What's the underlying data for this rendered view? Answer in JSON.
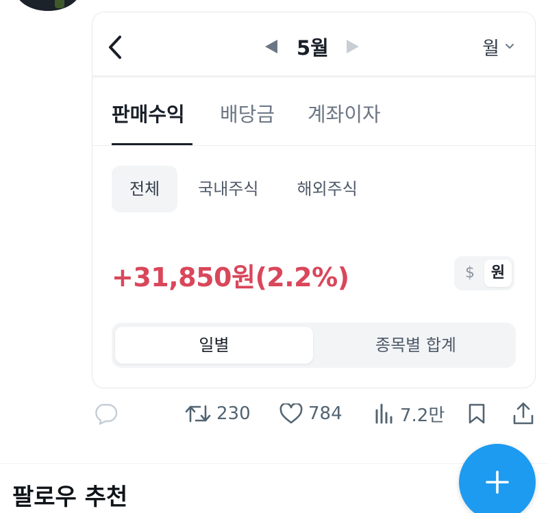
{
  "card": {
    "header": {
      "back_icon": "chevron-left-icon",
      "month": "5월",
      "prev_icon": "triangle-left-icon",
      "next_icon": "triangle-right-icon",
      "period_label": "월",
      "period_icon": "chevron-down-icon"
    },
    "tabs": [
      {
        "label": "판매수익",
        "active": true
      },
      {
        "label": "배당금",
        "active": false
      },
      {
        "label": "계좌이자",
        "active": false
      }
    ],
    "chips": [
      {
        "label": "전체",
        "active": true
      },
      {
        "label": "국내주식",
        "active": false
      },
      {
        "label": "해외주식",
        "active": false
      }
    ],
    "profit_text": "+31,850원(2.2%)",
    "currency": {
      "usd": "$",
      "krw": "원",
      "selected": "원"
    },
    "segments": [
      {
        "label": "일별",
        "active": true
      },
      {
        "label": "종목별 합계",
        "active": false
      }
    ]
  },
  "tweet_actions": {
    "reply_icon": "reply-icon",
    "retweet": {
      "icon": "retweet-icon",
      "count": "230"
    },
    "like": {
      "icon": "heart-icon",
      "count": "784"
    },
    "views": {
      "icon": "bar-chart-icon",
      "count": "7.2만"
    },
    "bookmark_icon": "bookmark-icon",
    "share_icon": "share-icon"
  },
  "follow_section": {
    "title": "팔로우 추천"
  },
  "fab": {
    "icon": "plus-icon"
  },
  "colors": {
    "profit": "#d9475a",
    "accent": "#1d9bf0",
    "tab_active": "#191f28",
    "tab_inactive": "#6b7684",
    "chip_bg": "#f2f4f6"
  }
}
